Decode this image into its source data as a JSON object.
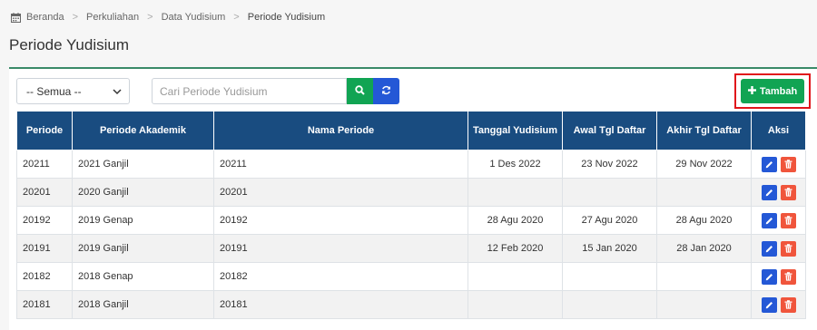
{
  "breadcrumb": {
    "items": [
      "Beranda",
      "Perkuliahan",
      "Data Yudisium",
      "Periode Yudisium"
    ]
  },
  "page_title": "Periode Yudisium",
  "filter": {
    "selected": "-- Semua --"
  },
  "search": {
    "placeholder": "Cari Periode Yudisium"
  },
  "toolbar": {
    "add_label": "Tambah"
  },
  "table": {
    "headers": [
      "Periode",
      "Periode Akademik",
      "Nama Periode",
      "Tanggal Yudisium",
      "Awal Tgl Daftar",
      "Akhir Tgl Daftar",
      "Aksi"
    ],
    "rows": [
      {
        "periode": "20211",
        "akademik": "2021 Ganjil",
        "nama": "20211",
        "tanggal": "1 Des 2022",
        "awal": "23 Nov 2022",
        "akhir": "29 Nov 2022"
      },
      {
        "periode": "20201",
        "akademik": "2020 Ganjil",
        "nama": "20201",
        "tanggal": "",
        "awal": "",
        "akhir": ""
      },
      {
        "periode": "20192",
        "akademik": "2019 Genap",
        "nama": "20192",
        "tanggal": "28 Agu 2020",
        "awal": "27 Agu 2020",
        "akhir": "28 Agu 2020"
      },
      {
        "periode": "20191",
        "akademik": "2019 Ganjil",
        "nama": "20191",
        "tanggal": "12 Feb 2020",
        "awal": "15 Jan 2020",
        "akhir": "28 Jan 2020"
      },
      {
        "periode": "20182",
        "akademik": "2018 Genap",
        "nama": "20182",
        "tanggal": "",
        "awal": "",
        "akhir": ""
      },
      {
        "periode": "20181",
        "akademik": "2018 Ganjil",
        "nama": "20181",
        "tanggal": "",
        "awal": "",
        "akhir": ""
      }
    ]
  },
  "colors": {
    "header_bg": "#194c80",
    "success": "#11a453",
    "primary": "#2458d6",
    "danger": "#f0553c",
    "highlight": "#e0161b"
  },
  "icons": {
    "home": "calendar-icon",
    "search": "search-icon",
    "refresh": "refresh-icon",
    "add": "plus-icon",
    "edit": "pencil-icon",
    "delete": "trash-icon"
  }
}
